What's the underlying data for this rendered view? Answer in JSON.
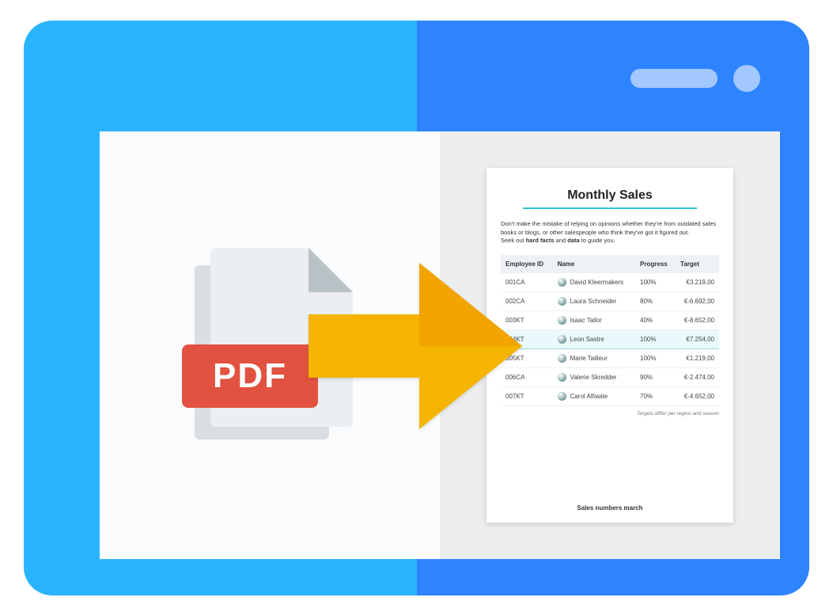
{
  "pdf": {
    "label": "PDF"
  },
  "report": {
    "title": "Monthly Sales",
    "blurb_1": "Don't make the mistake of relying on opinions whether they're from outdated sales books or blogs, or other salespeople who think they've got it figured out.",
    "blurb_2a": "Seek out ",
    "blurb_2b": "hard facts",
    "blurb_2c": " and ",
    "blurb_2d": "data",
    "blurb_2e": " to guide you.",
    "columns": {
      "id": "Employee ID",
      "name": "Name",
      "progress": "Progress",
      "target": "Target"
    },
    "rows": [
      {
        "id": "001CA",
        "name": "David Kleermakers",
        "progress": "100%",
        "target": "€3.219,00",
        "highlight": false
      },
      {
        "id": "002CA",
        "name": "Laura Schneider",
        "progress": "80%",
        "target": "€-6.692,00",
        "highlight": false
      },
      {
        "id": "003KT",
        "name": "Isaac Tailor",
        "progress": "40%",
        "target": "€-8.652,00",
        "highlight": false
      },
      {
        "id": "004KT",
        "name": "Leon Sastre",
        "progress": "100%",
        "target": "€7.254,00",
        "highlight": true
      },
      {
        "id": "005KT",
        "name": "Marie Tailleur",
        "progress": "100%",
        "target": "€1.219,00",
        "highlight": false
      },
      {
        "id": "006CA",
        "name": "Valerie Skredder",
        "progress": "90%",
        "target": "€-2.474,00",
        "highlight": false
      },
      {
        "id": "007KT",
        "name": "Carol Alfaiate",
        "progress": "70%",
        "target": "€-4.652,00",
        "highlight": false
      }
    ],
    "footnote": "Targets differ per region and season",
    "caption": "Sales numbers march"
  }
}
